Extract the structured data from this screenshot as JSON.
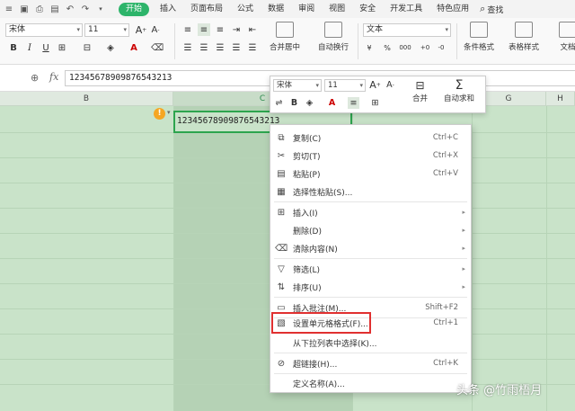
{
  "menubar": {
    "quick_access_icons": [
      "menu-icon",
      "save-icon",
      "print-icon",
      "preview-icon",
      "undo-icon",
      "redo-icon",
      "dropdown-icon"
    ],
    "items": [
      "开始",
      "插入",
      "页面布局",
      "公式",
      "数据",
      "审阅",
      "视图",
      "安全",
      "开发工具",
      "特色应用"
    ],
    "active": "开始",
    "search_label": "查找"
  },
  "ribbon": {
    "font_name": "宋体",
    "font_size": "11",
    "number_format": "文本",
    "merge_label": "合并居中",
    "wrap_label": "自动换行",
    "cond_format_label": "条件格式",
    "table_style_label": "表格样式",
    "doc_label": "文档"
  },
  "formula_bar": {
    "content": "12345678909876543213"
  },
  "grid": {
    "columns": [
      "B",
      "C",
      "G",
      "H"
    ],
    "active_cell_value": "12345678909876543213",
    "warning_icon": "!"
  },
  "mini_toolbar": {
    "font_name": "宋体",
    "font_size": "11",
    "merge_label": "合并",
    "autosum_label": "自动求和"
  },
  "context_menu": {
    "items": [
      {
        "label": "复制(C)",
        "shortcut": "Ctrl+C",
        "icon": "copy-icon"
      },
      {
        "label": "剪切(T)",
        "shortcut": "Ctrl+X",
        "icon": "cut-icon"
      },
      {
        "label": "粘贴(P)",
        "shortcut": "Ctrl+V",
        "icon": "paste-icon"
      },
      {
        "label": "选择性粘贴(S)...",
        "shortcut": "",
        "icon": "paste-special-icon"
      },
      {
        "label": "插入(I)",
        "shortcut": "",
        "icon": "insert-icon",
        "submenu": true
      },
      {
        "label": "删除(D)",
        "shortcut": "",
        "icon": "",
        "submenu": true
      },
      {
        "label": "清除内容(N)",
        "shortcut": "",
        "icon": "eraser-icon",
        "submenu": true
      },
      {
        "label": "筛选(L)",
        "shortcut": "",
        "icon": "filter-icon",
        "submenu": true
      },
      {
        "label": "排序(U)",
        "shortcut": "",
        "icon": "sort-icon",
        "submenu": true
      },
      {
        "label": "插入批注(M)...",
        "shortcut": "Shift+F2",
        "icon": "comment-icon"
      },
      {
        "label": "设置单元格格式(F)...",
        "shortcut": "Ctrl+1",
        "icon": "format-cells-icon"
      },
      {
        "label": "从下拉列表中选择(K)...",
        "shortcut": "",
        "icon": ""
      },
      {
        "label": "超链接(H)...",
        "shortcut": "Ctrl+K",
        "icon": "link-icon"
      },
      {
        "label": "定义名称(A)...",
        "shortcut": "",
        "icon": ""
      }
    ]
  },
  "watermark": "头条 @竹雨梧月",
  "colors": {
    "accent": "#2db46a",
    "sheet_bg": "#c9e3c9",
    "selected_col": "#b5d2b5",
    "highlight_box": "#e03030",
    "warning": "#f5a623"
  }
}
